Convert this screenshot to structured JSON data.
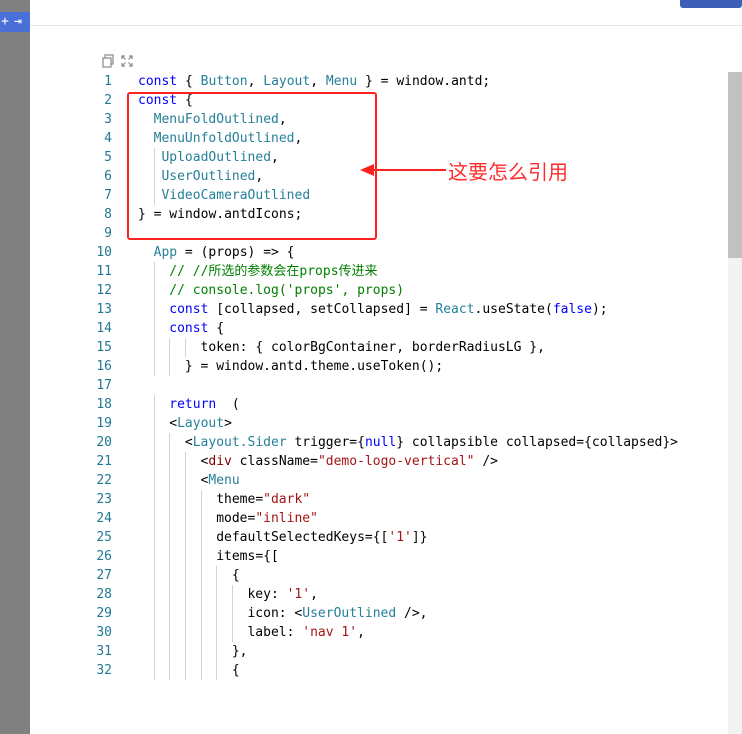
{
  "left_panel": {
    "tab_icons": [
      "plus-icon",
      "exit-icon"
    ]
  },
  "toolbar": {
    "copy_icon": "copy-icon",
    "fullscreen_icon": "fullscreen-icon"
  },
  "annotation": {
    "text": "这要怎么引用",
    "color": "#ff2d2d"
  },
  "code_lines": [
    {
      "n": "1",
      "indent": 0,
      "tokens": [
        [
          "keyword",
          "const"
        ],
        [
          "plain",
          " { "
        ],
        [
          "class",
          "Button"
        ],
        [
          "plain",
          ", "
        ],
        [
          "class",
          "Layout"
        ],
        [
          "plain",
          ", "
        ],
        [
          "class",
          "Menu"
        ],
        [
          "plain",
          " } = window.antd;"
        ]
      ]
    },
    {
      "n": "2",
      "indent": 0,
      "tokens": [
        [
          "keyword",
          "const"
        ],
        [
          "plain",
          " {"
        ]
      ]
    },
    {
      "n": "3",
      "indent": 2,
      "tokens": [
        [
          "class",
          "MenuFoldOutlined"
        ],
        [
          "plain",
          ","
        ]
      ]
    },
    {
      "n": "4",
      "indent": 2,
      "tokens": [
        [
          "class",
          "MenuUnfoldOutlined"
        ],
        [
          "plain",
          ","
        ]
      ]
    },
    {
      "n": "5",
      "indent": 3,
      "tokens": [
        [
          "class",
          "UploadOutlined"
        ],
        [
          "plain",
          ","
        ]
      ]
    },
    {
      "n": "6",
      "indent": 3,
      "tokens": [
        [
          "class",
          "UserOutlined"
        ],
        [
          "plain",
          ","
        ]
      ]
    },
    {
      "n": "7",
      "indent": 3,
      "tokens": [
        [
          "class",
          "VideoCameraOutlined"
        ]
      ]
    },
    {
      "n": "8",
      "indent": 0,
      "tokens": [
        [
          "plain",
          "} = window.antdIcons;"
        ]
      ]
    },
    {
      "n": "9",
      "indent": 0,
      "tokens": []
    },
    {
      "n": "10",
      "indent": 2,
      "tokens": [
        [
          "class",
          "App"
        ],
        [
          "plain",
          " = (props) => {"
        ]
      ]
    },
    {
      "n": "11",
      "indent": 4,
      "tokens": [
        [
          "comment",
          "// //所选的参数会在props传进来"
        ]
      ]
    },
    {
      "n": "12",
      "indent": 4,
      "tokens": [
        [
          "comment",
          "// console.log('props', props)"
        ]
      ]
    },
    {
      "n": "13",
      "indent": 4,
      "tokens": [
        [
          "keyword",
          "const"
        ],
        [
          "plain",
          " [collapsed, setCollapsed] = "
        ],
        [
          "class",
          "React"
        ],
        [
          "plain",
          ".useState("
        ],
        [
          "keyword",
          "false"
        ],
        [
          "plain",
          ");"
        ]
      ]
    },
    {
      "n": "14",
      "indent": 4,
      "tokens": [
        [
          "keyword",
          "const"
        ],
        [
          "plain",
          " {"
        ]
      ]
    },
    {
      "n": "15",
      "indent": 8,
      "tokens": [
        [
          "plain",
          "token: { colorBgContainer, borderRadiusLG },"
        ]
      ]
    },
    {
      "n": "16",
      "indent": 6,
      "tokens": [
        [
          "plain",
          "} = window.antd.theme.useToken();"
        ]
      ]
    },
    {
      "n": "17",
      "indent": 0,
      "tokens": []
    },
    {
      "n": "18",
      "indent": 4,
      "tokens": [
        [
          "keyword",
          "return"
        ],
        [
          "plain",
          "  ("
        ]
      ]
    },
    {
      "n": "19",
      "indent": 4,
      "tokens": [
        [
          "plain",
          "<"
        ],
        [
          "class",
          "Layout"
        ],
        [
          "plain",
          ">"
        ]
      ]
    },
    {
      "n": "20",
      "indent": 6,
      "tokens": [
        [
          "plain",
          "<"
        ],
        [
          "class",
          "Layout.Sider"
        ],
        [
          "plain",
          " trigger={"
        ],
        [
          "keyword",
          "null"
        ],
        [
          "plain",
          "} collapsible collapsed={collapsed}>"
        ]
      ]
    },
    {
      "n": "21",
      "indent": 8,
      "tokens": [
        [
          "plain",
          "<"
        ],
        [
          "tag",
          "div"
        ],
        [
          "plain",
          " className="
        ],
        [
          "string",
          "\"demo-logo-vertical\""
        ],
        [
          "plain",
          " />"
        ]
      ]
    },
    {
      "n": "22",
      "indent": 8,
      "tokens": [
        [
          "plain",
          "<"
        ],
        [
          "class",
          "Menu"
        ]
      ]
    },
    {
      "n": "23",
      "indent": 10,
      "tokens": [
        [
          "plain",
          "theme="
        ],
        [
          "string",
          "\"dark\""
        ]
      ]
    },
    {
      "n": "24",
      "indent": 10,
      "tokens": [
        [
          "plain",
          "mode="
        ],
        [
          "string",
          "\"inline\""
        ]
      ]
    },
    {
      "n": "25",
      "indent": 10,
      "tokens": [
        [
          "plain",
          "defaultSelectedKeys={["
        ],
        [
          "string",
          "'1'"
        ],
        [
          "plain",
          "]}"
        ]
      ]
    },
    {
      "n": "26",
      "indent": 10,
      "tokens": [
        [
          "plain",
          "items={["
        ]
      ]
    },
    {
      "n": "27",
      "indent": 12,
      "tokens": [
        [
          "plain",
          "{"
        ]
      ]
    },
    {
      "n": "28",
      "indent": 14,
      "tokens": [
        [
          "plain",
          "key: "
        ],
        [
          "string",
          "'1'"
        ],
        [
          "plain",
          ","
        ]
      ]
    },
    {
      "n": "29",
      "indent": 14,
      "tokens": [
        [
          "plain",
          "icon: <"
        ],
        [
          "class",
          "UserOutlined"
        ],
        [
          "plain",
          " />,"
        ]
      ]
    },
    {
      "n": "30",
      "indent": 14,
      "tokens": [
        [
          "plain",
          "label: "
        ],
        [
          "string",
          "'nav 1'"
        ],
        [
          "plain",
          ","
        ]
      ]
    },
    {
      "n": "31",
      "indent": 12,
      "tokens": [
        [
          "plain",
          "},"
        ]
      ]
    },
    {
      "n": "32",
      "indent": 12,
      "tokens": [
        [
          "plain",
          "{"
        ]
      ]
    }
  ]
}
